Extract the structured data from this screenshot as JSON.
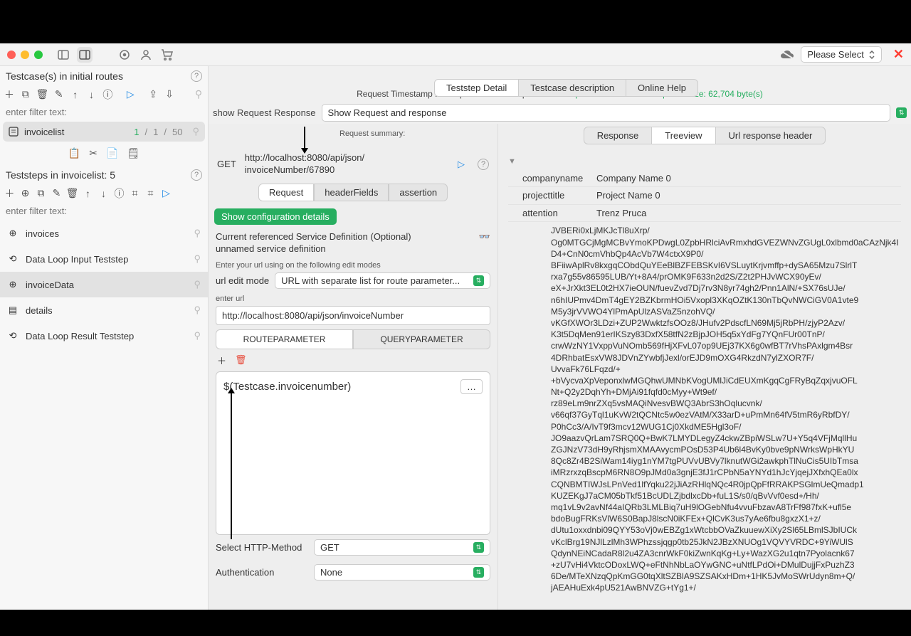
{
  "titlebar": {
    "please_select": "Please Select"
  },
  "left": {
    "header1": "Testcase(s) in initial routes",
    "filter_placeholder": "enter filter text:",
    "testcase": {
      "name": "invoicelist",
      "passed": "1",
      "sep1": "/",
      "cur": "1",
      "sep2": "/",
      "total": "50"
    },
    "header2": "Teststeps in invoicelist: 5",
    "steps": {
      "s1": "invoices",
      "s2": "Data Loop Input Teststep",
      "s3": "invoiceData",
      "s4": "details",
      "s5": "Data Loop Result Teststep"
    }
  },
  "center_tabs": {
    "t1": "Teststep Detail",
    "t2": "Testcase description",
    "t3": "Online Help"
  },
  "status": {
    "req_ts_label": "Request Timestamp :",
    "resp_ts_label": "Response Timestamp :",
    "http_status": "HTTP response status 200",
    "resp_size": "Response size: 62,704 byte(s)"
  },
  "mid": {
    "show_label": "show Request Response",
    "show_value": "Show Request and response",
    "req_summary": "Request summary:",
    "method": "GET",
    "url_line1": "http://localhost:8080/api/json/",
    "url_line2": "invoiceNumber/67890",
    "subtabs": {
      "t1": "Request",
      "t2": "headerFields",
      "t3": "assertion"
    },
    "config_btn": "Show configuration details",
    "refdef1": "Current referenced Service Definition (Optional)",
    "refdef2": "unnamed service definition",
    "edit_modes_label": "Enter your url using on the following edit modes",
    "url_edit_mode_label": "url edit mode",
    "url_edit_mode_value": "URL with separate list for route parameter...",
    "enter_url_label": "enter url",
    "enter_url_value": "http://localhost:8080/api/json/invoiceNumber",
    "param_tabs": {
      "t1": "ROUTEPARAMETER",
      "t2": "QUERYPARAMETER"
    },
    "param_value": "$(Testcase.invoicenumber)",
    "http_method_label": "Select HTTP-Method",
    "http_method_value": "GET",
    "auth_label": "Authentication",
    "auth_value": "None"
  },
  "right": {
    "tabs": {
      "t1": "Response",
      "t2": "Treeview",
      "t3": "Url response header"
    },
    "kv": {
      "k1": "companyname",
      "v1": "Company Name 0",
      "k2": "projecttitle",
      "v2": "Project Name 0",
      "k3": "attention",
      "v3": "Trenz Pruca"
    },
    "block": "JVBERi0xLjMKJcTl8uXrp/\nOg0MTGCjMgMCBvYmoKPDwgL0ZpbHRlciAvRmxhdGVEZWNvZGUgL0xlbmd0aCAzNjk4ID4+CnN0cmVhbQp4AcVb7W4ctxX9P0/\nBFiiwAplRv8kxgqCObdQuYEeBlBZFEBSKvI6VSLuytKrjvmffp+dySA65Mzu7SlrlT\nrxa7g55v86595LUB/Yt+8A4/prOMK9F633n2d2S/Z2t2PHJvWCX90yEv/\neX+JrXkt3EL0t2HX7ieOUN/fuevZvd7Dj7rv3N8yr74gh2/Pnn1AlN/+SX76sUJe/\nn6hIUPmv4DmT4gEY2BZKbrmHOi5Vxopl3XKqOZtK130nTbQvNWCiGV0A1vte9\nM5y3jrVVWO4YlPmApUlzASVaZ5nzohVQ/\nvKGfXWOr3LDzi+ZUP2WwktzfsOOz8/JHufv2PdscfLN69Mj5jRbPH/zjyP2Azv/\nK3t5DqMen91erIKSzy83DxfX58tfN2zBjpJOH5q5xYdFg7YQnFUr00TnP/\ncrwWzNY1VxppVuNOmb569fHjXFvL07op9UEj37KX6g0wfBT7rVhsPAxlgm4Bsr\n4DRhbatEsxVW8JDVnZYwbfjJexl/orEJD9mOXG4RkzdN7ylZXOR7F/\nUvvaFk76LFqzd/+\n+bVycvaXpVeponxlwMGQhwUMNbKVogUMlJiCdEUXmKgqCgFRyBqZqxjvuOFL\nNt+Q2y2DqhYh+DMjAi91fqfd0cMyy+Wt9ef/\nrz89eLm9nrZXq5vsMAQiNvesvBWQ3AbrS3hOqlucvnk/\nv66qf37GyTql1uKvW2tQCNtc5w0ezVAtM/X33arD+uPmMn64fV5tmR6yRbfDY/\nP0hCc3/A/IvT9f3mcv12WUG1Cj0XkdME5Hgl3oF/\nJO9aazvQrLam7SRQ0Q+BwK7LMYDLegyZ4ckwZBpiWSLw7U+Y5q4VFjMqllHu\nZGJNzV73dH9yRhjsmXMAAvycmPOsD53P4Ub6l4BvKy0bve9pNWrksWpHkYU\n8Qc8Zr4B2SiWam14iyg1nYM7tgPUVvUBVy7lknutWGi2awkphTlNuCis5UIbTmsa\niMRzrxzqBscpM6RN8O9pJMd0a3gnjE3fJ1rCPbN5aYNYd1hJcYjqejJXfxhQEa0lx\nCQNBMTIWJsLPnVed1lfYqku22jJiAzRHlqNQc4R0jpQpFfRRAKPSGlmUeQmadp1\nKUZEKgJ7aCM05bTkf51BcUDLZjbdlxcDb+fuL1S/s0/qBvVvf0esd+/Hh/\nmq1vL9v2avNf44aIQRb3LMLBiq7uH9lOGebNfu4vvuFbzavA8TrFf987fxK+ufl5e\nbdoBugFRKsVlW6S0BapJ8lscN0iKFEx+QlCvK3us7yAe6fbu8gxzX1+z/\ndUtu1oxxdnbi09QYY53oVj0wEBZg1xWtcbbOVaZkuuewXiXy2Sl65LBmlSJbIUCk\nvKclBrg19NJlLzlMh3WPhzssjqgp0tb25JkN2JBzXNUOg1VQVYVRDC+9YiWUlS\nQdynNEiNCadaR8l2u4ZA3cnrWkF0kiZwnKqKg+Ly+WazXG2u1qtn7Pyolacnk67\n+zU7vHi4VktcODoxLWQ+eFtNhNbLaOYwGNC+uNtfLPdOi+DMulDujjFxPuzhZ3\n6De/MTeXNzqQpKmGG0tqXltSZBlA9SZSAKxHDm+1HK5JvMoSWrUdyn8m+Q/\njAEAHuExk4pU521AwBNVZG+tYg1+/"
  }
}
